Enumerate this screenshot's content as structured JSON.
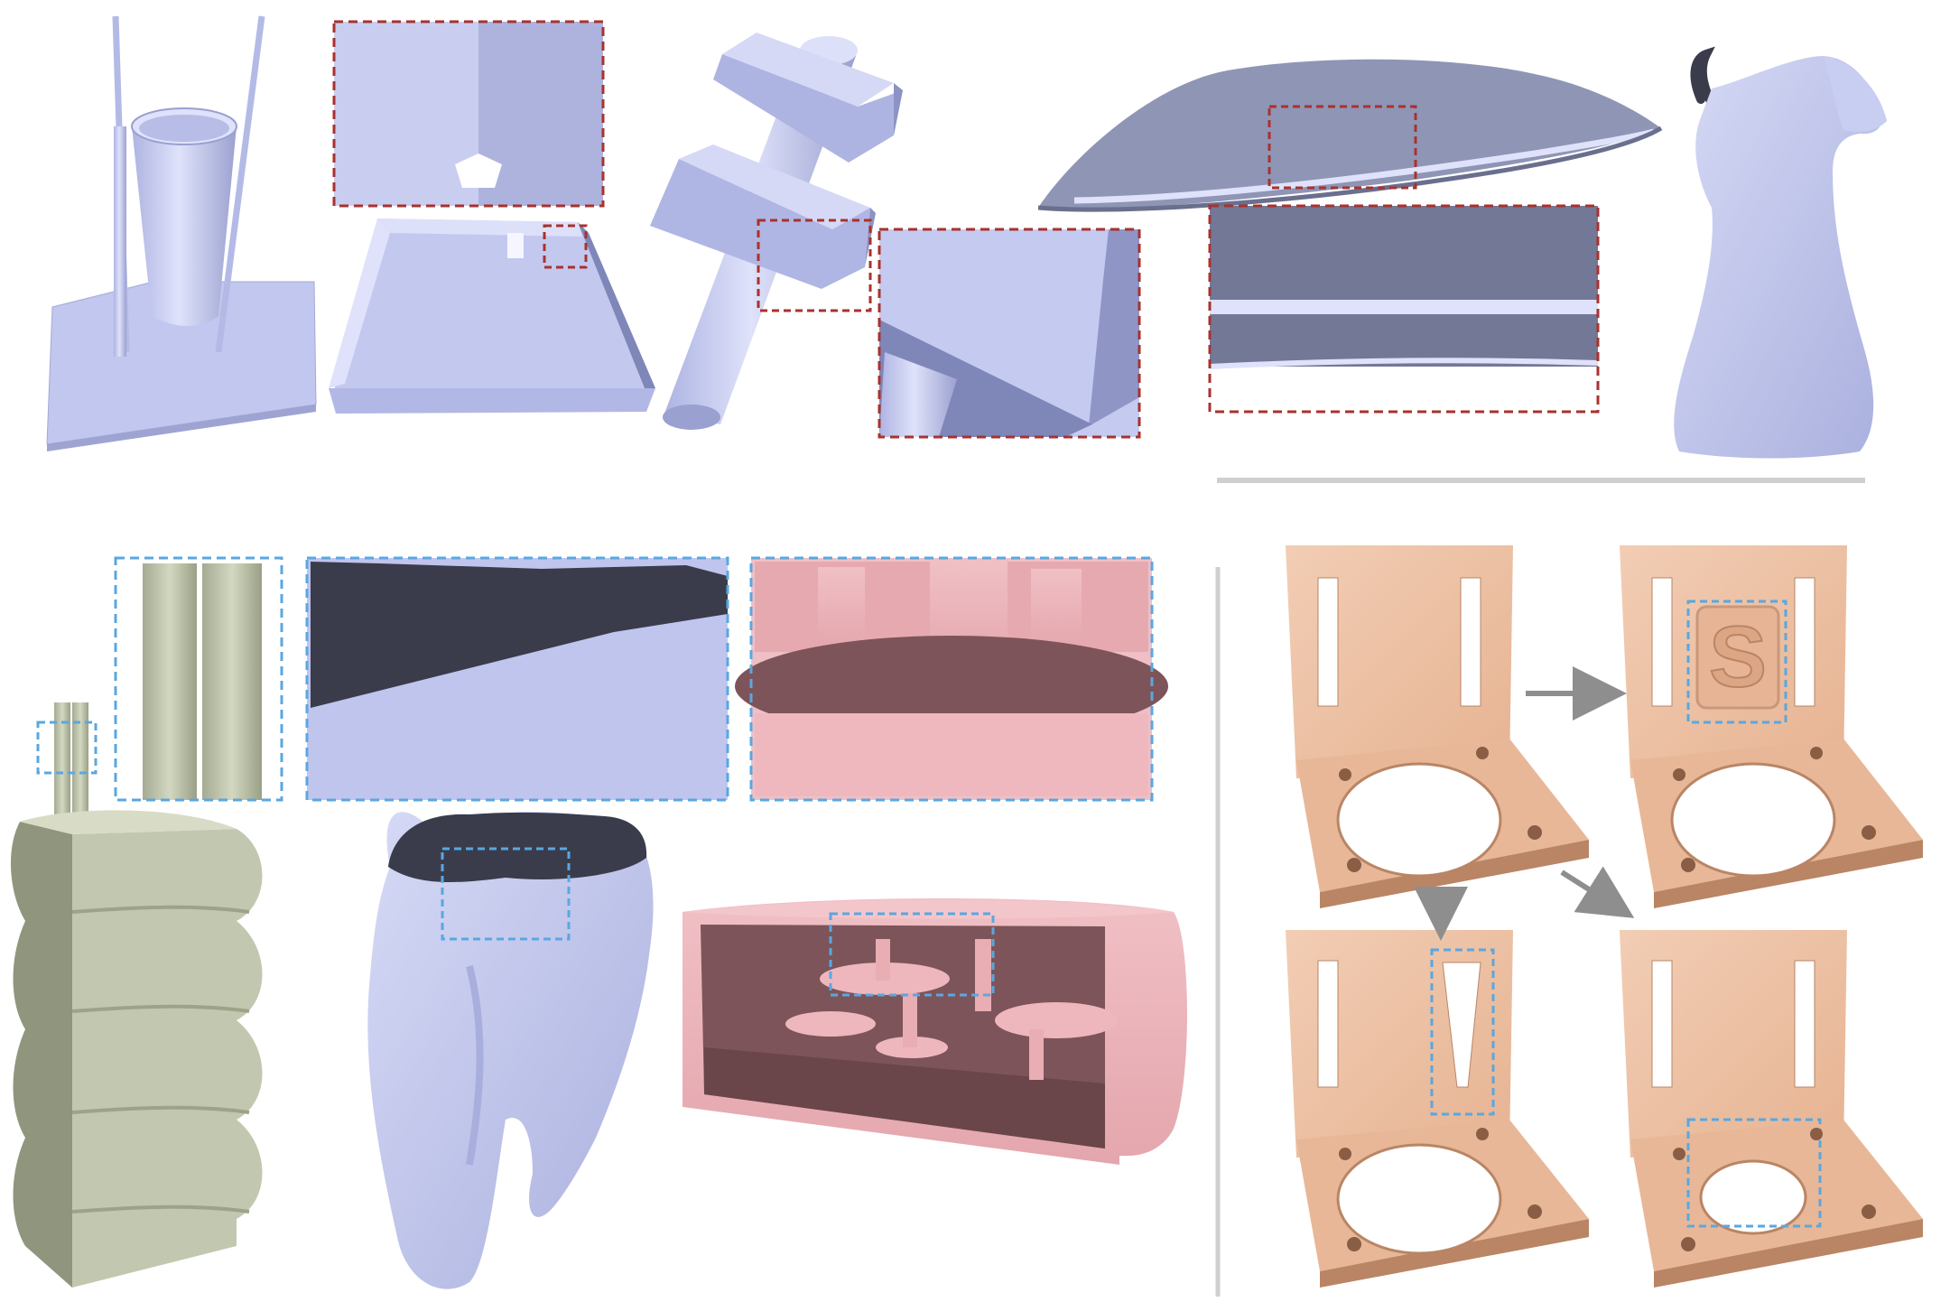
{
  "figure": {
    "panels": [
      {
        "id": "cup-on-plate",
        "group": "top",
        "shading": "lavender"
      },
      {
        "id": "open-tray",
        "group": "top",
        "shading": "lavender",
        "zoom": "red-dashed"
      },
      {
        "id": "cylinder-with-blocks",
        "group": "top",
        "shading": "lavender",
        "zoom": "red-dashed"
      },
      {
        "id": "thin-sheet",
        "group": "top",
        "shading": "lavender",
        "zoom": "red-dashed"
      },
      {
        "id": "dress",
        "group": "top",
        "shading": "lavender"
      },
      {
        "id": "ridged-column",
        "group": "bottom-left",
        "shading": "sage",
        "zoom": "blue-dashed"
      },
      {
        "id": "bone-mesh",
        "group": "bottom-left",
        "shading": "lavender",
        "zoom": "blue-dashed"
      },
      {
        "id": "gear-box",
        "group": "bottom-left",
        "shading": "pink",
        "zoom": "blue-dashed"
      },
      {
        "id": "bracket-edits",
        "group": "bottom-right",
        "shading": "peach",
        "zoom": "blue-dashed"
      }
    ],
    "bracket_text": "S",
    "colors": {
      "lavender": "#c4c9ef",
      "lavender_dark": "#8f95bd",
      "slate": "#737896",
      "sage": "#c4cab2",
      "sage_dark": "#8f967d",
      "pink": "#e8b0b6",
      "maroon": "#7d5459",
      "peach": "#ecc0a4",
      "peach_dark": "#b98565",
      "red_dash": "#a8322e",
      "blue_dash": "#5aa7e0",
      "divider": "#cfcfcf",
      "arrow": "#8e8e8e",
      "navy": "#3a3c4c"
    }
  }
}
